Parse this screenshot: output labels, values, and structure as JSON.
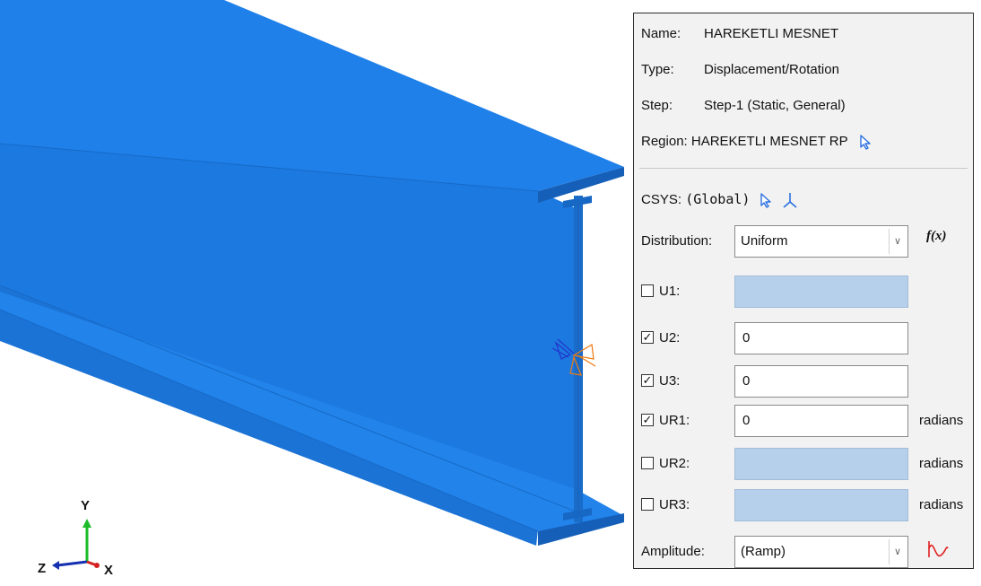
{
  "view": {
    "triad": {
      "y": "Y",
      "z": "Z",
      "x": "X"
    }
  },
  "panel": {
    "name": {
      "label": "Name:",
      "value": "HAREKETLI MESNET"
    },
    "type": {
      "label": "Type:",
      "value": "Displacement/Rotation"
    },
    "step": {
      "label": "Step:",
      "value": "Step-1 (Static, General)"
    },
    "region": {
      "label": "Region:",
      "value": "HAREKETLI MESNET RP"
    },
    "csys": {
      "label": "CSYS:",
      "value": "(Global)"
    },
    "distribution": {
      "label": "Distribution:",
      "value": "Uniform",
      "fx_label": "f(x)"
    },
    "dofs": [
      {
        "label": "U1:",
        "checked": false,
        "value": "",
        "unit": ""
      },
      {
        "label": "U2:",
        "checked": true,
        "value": "0",
        "unit": ""
      },
      {
        "label": "U3:",
        "checked": true,
        "value": "0",
        "unit": ""
      },
      {
        "label": "UR1:",
        "checked": true,
        "value": "0",
        "unit": "radians"
      },
      {
        "label": "UR2:",
        "checked": false,
        "value": "",
        "unit": "radians"
      },
      {
        "label": "UR3:",
        "checked": false,
        "value": "",
        "unit": "radians"
      }
    ],
    "amplitude": {
      "label": "Amplitude:",
      "value": "(Ramp)"
    }
  },
  "colors": {
    "beam_top": "#1f7fe6",
    "beam_side": "#1b74d6",
    "disabled_field": "#b6cfea",
    "accent_blue": "#2a6fe0",
    "icon_red": "#e02020"
  }
}
